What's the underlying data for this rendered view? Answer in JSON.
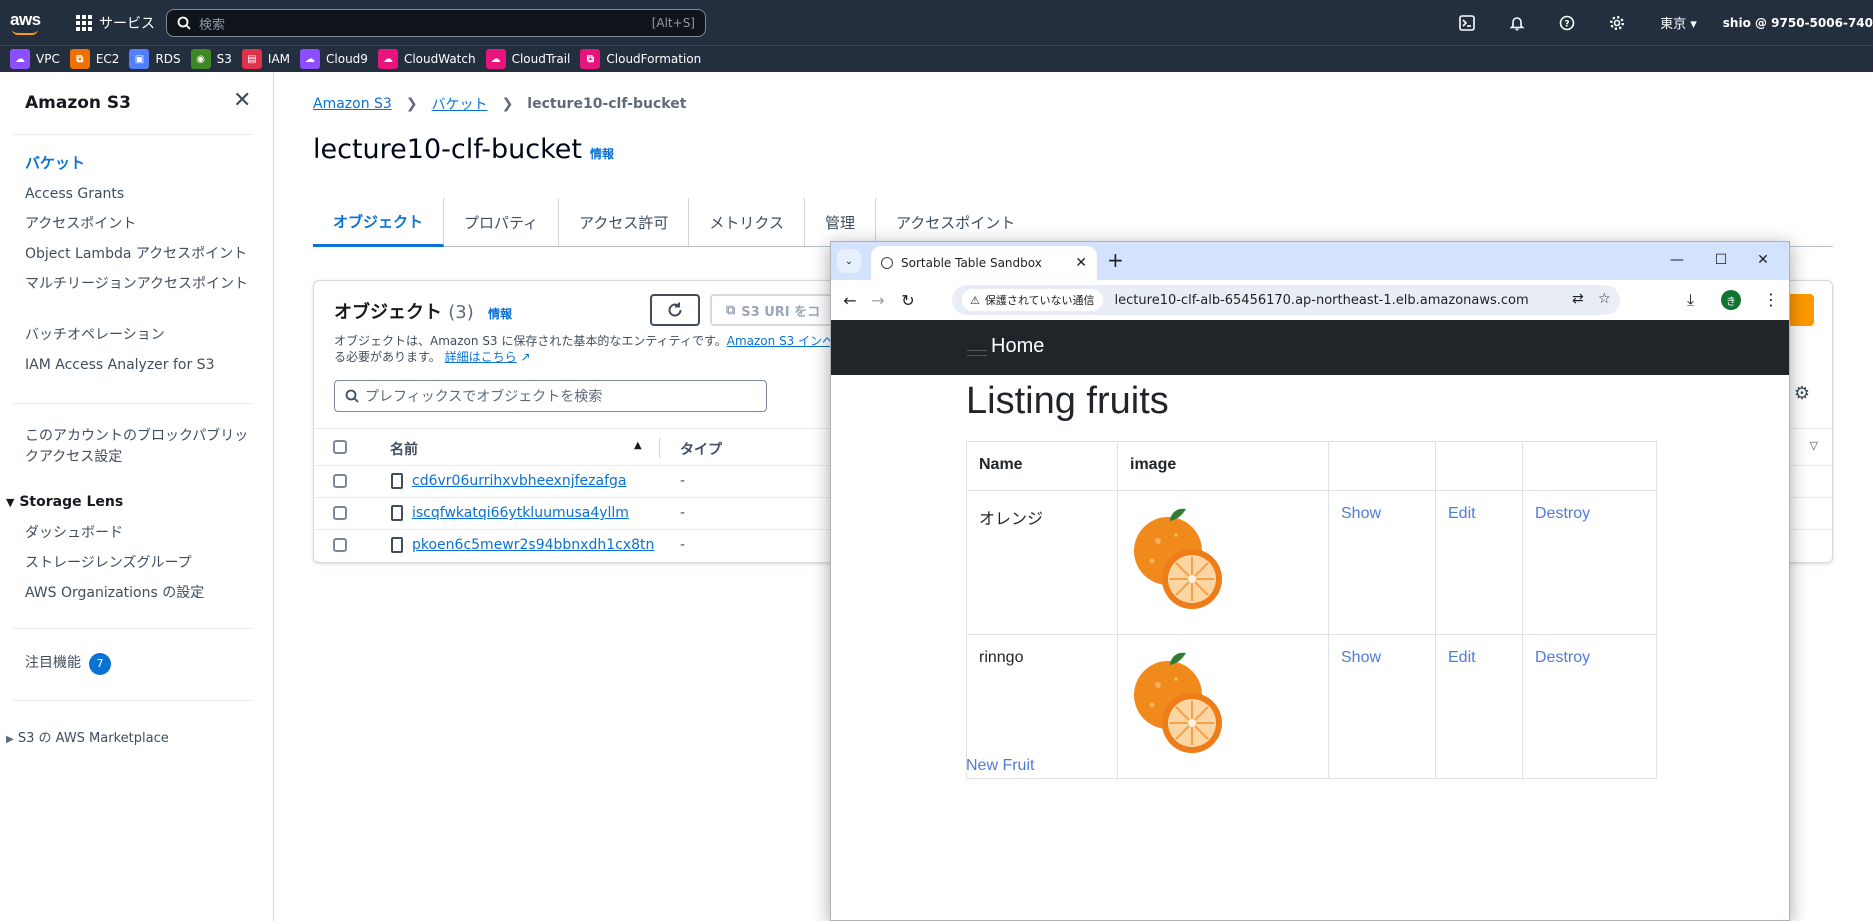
{
  "topnav": {
    "logo": "aws",
    "services_label": "サービス",
    "search_placeholder": "検索",
    "search_shortcut": "[Alt+S]",
    "region": "東京 ▾",
    "account": "shio @ 9750-5006-740"
  },
  "favorites": [
    {
      "label": "VPC",
      "color": "#8c4fff"
    },
    {
      "label": "EC2",
      "color": "#ed7100"
    },
    {
      "label": "RDS",
      "color": "#527fff"
    },
    {
      "label": "S3",
      "color": "#3f8624"
    },
    {
      "label": "IAM",
      "color": "#dd344c"
    },
    {
      "label": "Cloud9",
      "color": "#8c4fff"
    },
    {
      "label": "CloudWatch",
      "color": "#e7157b"
    },
    {
      "label": "CloudTrail",
      "color": "#e7157b"
    },
    {
      "label": "CloudFormation",
      "color": "#e7157b"
    }
  ],
  "sidebar": {
    "title": "Amazon S3",
    "items": [
      "バケット",
      "Access Grants",
      "アクセスポイント",
      "Object Lambda アクセスポイント",
      "マルチリージョンアクセスポイント",
      "バッチオペレーション",
      "IAM Access Analyzer for S3"
    ],
    "block_public": "このアカウントのブロックパブリックアクセス設定",
    "storage_lens": {
      "title": "Storage Lens",
      "items": [
        "ダッシュボード",
        "ストレージレンズグループ",
        "AWS Organizations の設定"
      ]
    },
    "featured": "注目機能",
    "featured_count": "7",
    "marketplace": "S3 の AWS Marketplace"
  },
  "breadcrumb": {
    "root": "Amazon S3",
    "buckets": "バケット",
    "current": "lecture10-clf-bucket"
  },
  "page": {
    "title": "lecture10-clf-bucket",
    "info": "情報"
  },
  "tabs": [
    "オブジェクト",
    "プロパティ",
    "アクセス許可",
    "メトリクス",
    "管理",
    "アクセスポイント"
  ],
  "objects": {
    "title": "オブジェクト",
    "count": "(3)",
    "info": "情報",
    "desc_prefix": "オブジェクトは、Amazon S3 に保存された基本的なエンティティです。",
    "desc_link": "Amazon S3 インベ",
    "desc_suffix": "る必要があります。",
    "details_link": "詳細はこちら",
    "copy_uri": "S3 URI をコ",
    "search_placeholder": "プレフィックスでオブジェクトを検索",
    "col_name": "名前",
    "col_type": "タイプ",
    "rows": [
      {
        "name": "cd6vr06urrihxvbheexnjfezafga",
        "type": "-"
      },
      {
        "name": "iscqfwkatqi66ytkluumusa4yllm",
        "type": "-"
      },
      {
        "name": "pkoen6c5mewr2s94bbnxdh1cx8tn",
        "type": "-"
      }
    ]
  },
  "browser": {
    "tab_title": "Sortable Table Sandbox",
    "security_label": "保護されていない通信",
    "url": "lecture10-clf-alb-65456170.ap-northeast-1.elb.amazonaws.com",
    "avatar_letter": "き"
  },
  "webpage": {
    "nav_home": "Home",
    "heading": "Listing fruits",
    "col_name": "Name",
    "col_image": "image",
    "rows": [
      {
        "name": "オレンジ",
        "show": "Show",
        "edit": "Edit",
        "destroy": "Destroy"
      },
      {
        "name": "rinngo",
        "show": "Show",
        "edit": "Edit",
        "destroy": "Destroy"
      }
    ],
    "new_link": "New Fruit"
  }
}
